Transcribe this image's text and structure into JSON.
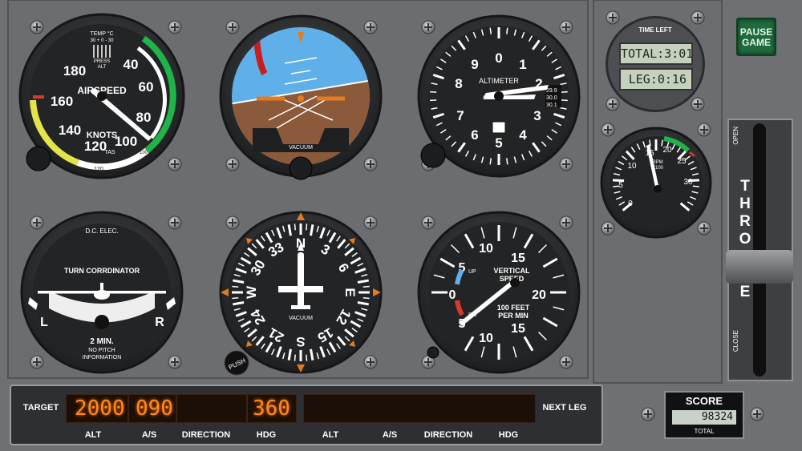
{
  "gauges": {
    "airspeed": {
      "temp_label": "TEMP °C",
      "temp_scale": "30 + 0 - 30",
      "press_label": "PRESS",
      "alt_label": "ALT",
      "title": "AIRSPEED",
      "unit": "KNOTS",
      "tas_label": "TAS",
      "ticks": [
        "40",
        "60",
        "80",
        "100",
        "120",
        "140",
        "160",
        "180"
      ],
      "tas_ticks": [
        "120",
        "100"
      ]
    },
    "attitude": {
      "label": "VACUUM"
    },
    "altimeter": {
      "title": "ALTIMETER",
      "ticks": [
        "0",
        "1",
        "2",
        "3",
        "4",
        "5",
        "6",
        "7",
        "8",
        "9"
      ],
      "kollsman": [
        "29.9",
        "30.0",
        "30.1"
      ]
    },
    "turn_coordinator": {
      "top_label": "D.C. ELEC.",
      "title": "TURN CORRDINATOR",
      "left": "L",
      "right": "R",
      "time": "2 MIN.",
      "note_line1": "NO PITCH",
      "note_line2": "INFORMATION"
    },
    "heading": {
      "label": "VACUUM",
      "cardinals": [
        "N",
        "3",
        "6",
        "E",
        "12",
        "15",
        "S",
        "21",
        "24",
        "W",
        "30",
        "33"
      ],
      "push_label": "PUSH"
    },
    "vsi": {
      "title_line1": "VERTICAL",
      "title_line2": "SPEED",
      "unit_line1": "100 FEET",
      "unit_line2": "PER MIN",
      "up": "UP",
      "dn": "DN",
      "ticks": [
        "0",
        "5",
        "10",
        "15",
        "20",
        "15",
        "10",
        "5"
      ]
    },
    "tach": {
      "unit_line1": "RPM",
      "unit_line2": "X100",
      "ticks": [
        "0",
        "5",
        "10",
        "15",
        "20",
        "25",
        "30"
      ]
    }
  },
  "timer": {
    "label": "TIME LEFT",
    "total": "TOTAL:3:01",
    "leg": "LEG:0:16"
  },
  "pause_button": {
    "line1": "PAUSE",
    "line2": "GAME"
  },
  "throttle": {
    "open": "OPEN",
    "close": "CLOSE",
    "title": "THROTTLE"
  },
  "hud": {
    "target_label": "TARGET",
    "next_leg_label": "NEXT LEG",
    "alt": "2000",
    "as": "090",
    "direction": "",
    "hdg": "360",
    "col_labels": [
      "ALT",
      "A/S",
      "DIRECTION",
      "HDG",
      "ALT",
      "A/S",
      "DIRECTION",
      "HDG"
    ]
  },
  "score": {
    "label": "SCORE",
    "value": "98324",
    "total_label": "TOTAL"
  },
  "colors": {
    "panel": "#6e7074",
    "led": "#ff8a1e",
    "green_arc": "#1fb34a",
    "white_arc": "#ffffff",
    "yellow_arc": "#e3e34a",
    "red_line": "#d83a2a",
    "sky": "#5fb0e8",
    "ground": "#8a5a3a"
  }
}
